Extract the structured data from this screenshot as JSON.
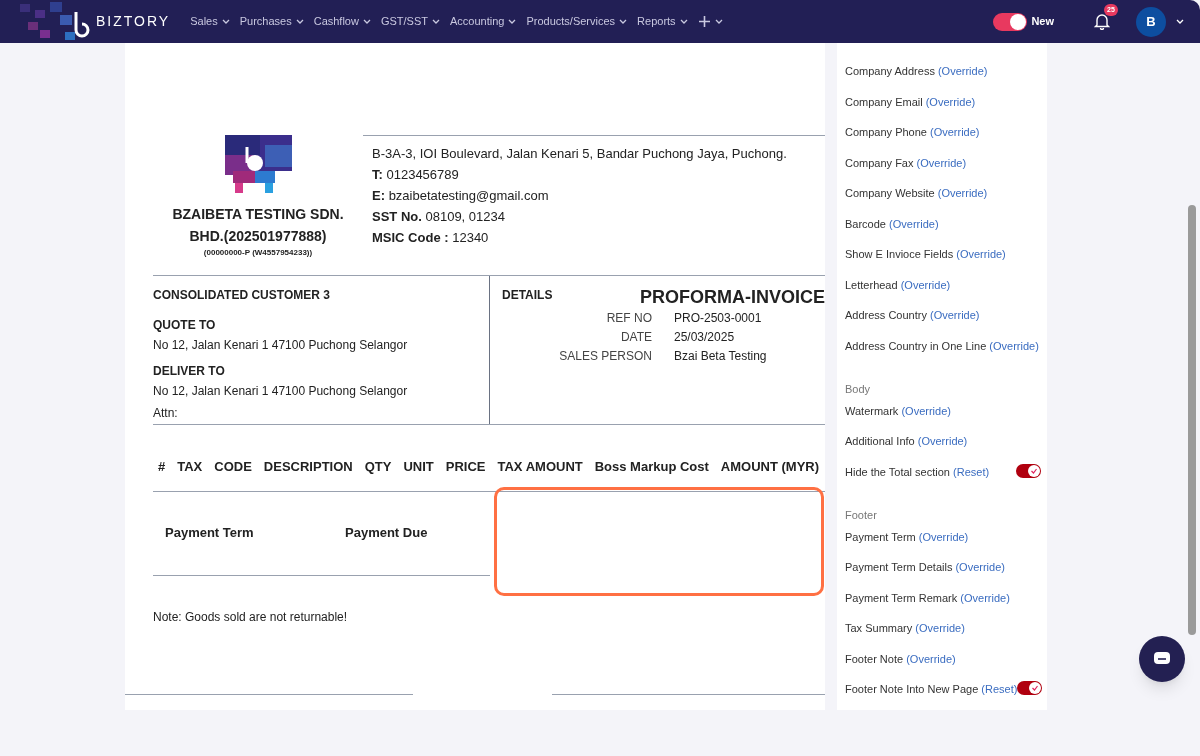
{
  "header": {
    "brand": "BIZTORY",
    "nav": [
      {
        "kind": "menu",
        "label": "Sales"
      },
      {
        "kind": "menu",
        "label": "Purchases"
      },
      {
        "kind": "menu",
        "label": "Cashflow"
      },
      {
        "kind": "menu",
        "label": "GST/SST"
      },
      {
        "kind": "menu",
        "label": "Accounting"
      },
      {
        "kind": "menu",
        "label": "Products/Services"
      },
      {
        "kind": "menu",
        "label": "Reports"
      },
      {
        "kind": "add"
      }
    ],
    "new_toggle": {
      "label": "New",
      "on": true
    },
    "notifications": "25",
    "avatar": "B"
  },
  "invoice": {
    "company_name": "BZAIBETA TESTING SDN. BHD.(202501977888)",
    "company_reg": "(00000000-P (W4557954233))",
    "address": "B-3A-3, IOI Boulevard, Jalan Kenari 5, Bandar Puchong Jaya, Puchong.",
    "contacts": [
      {
        "label": "T:",
        "value": "0123456789"
      },
      {
        "label": "E:",
        "value": "bzaibetatesting@gmail.com"
      },
      {
        "label": "SST No.",
        "value": "08109, 01234"
      },
      {
        "label": "MSIC Code :",
        "value": "12340"
      }
    ],
    "customer": "CONSOLIDATED CUSTOMER 3",
    "quote_to_label": "QUOTE TO",
    "quote_to": "No 12, Jalan Kenari 1 47100 Puchong Selangor",
    "deliver_to_label": "DELIVER TO",
    "deliver_to": "No 12, Jalan Kenari 1 47100 Puchong Selangor",
    "attn": "Attn:",
    "details_label": "DETAILS",
    "doc_title": "PROFORMA-INVOICE",
    "details": [
      {
        "label": "REF NO",
        "value": "PRO-2503-0001"
      },
      {
        "label": "DATE",
        "value": "25/03/2025"
      },
      {
        "label": "SALES PERSON",
        "value": "Bzai Beta Testing"
      }
    ],
    "columns": [
      "#",
      "TAX",
      "CODE",
      "DESCRIPTION",
      "QTY",
      "UNIT",
      "PRICE",
      "TAX AMOUNT",
      "Boss Markup Cost",
      "AMOUNT (MYR)"
    ],
    "payment_term": "Payment Term",
    "payment_due": "Payment Due",
    "note": "Note: Goods sold are not returnable!"
  },
  "settings": [
    {
      "items": [
        {
          "label": "Company Address",
          "action": "(Override)"
        },
        {
          "label": "Company Email",
          "action": "(Override)"
        },
        {
          "label": "Company Phone",
          "action": "(Override)"
        },
        {
          "label": "Company Fax",
          "action": "(Override)"
        },
        {
          "label": "Company Website",
          "action": "(Override)"
        },
        {
          "label": "Barcode",
          "action": "(Override)"
        },
        {
          "label": "Show E Invioce Fields",
          "action": "(Override)"
        },
        {
          "label": "Letterhead",
          "action": "(Override)"
        },
        {
          "label": "Address Country",
          "action": "(Override)"
        },
        {
          "label": "Address Country in One Line",
          "action": "(Override)"
        }
      ]
    },
    {
      "heading": "Body",
      "items": [
        {
          "label": "Watermark",
          "action": "(Override)"
        },
        {
          "label": "Additional Info",
          "action": "(Override)"
        },
        {
          "label": "Hide the Total section",
          "action": "(Reset)",
          "toggle": {
            "on": true
          }
        }
      ]
    },
    {
      "heading": "Footer",
      "items": [
        {
          "label": "Payment Term",
          "action": "(Override)"
        },
        {
          "label": "Payment Term Details",
          "action": "(Override)"
        },
        {
          "label": "Payment Term Remark",
          "action": "(Override)"
        },
        {
          "label": "Tax Summary",
          "action": "(Override)"
        },
        {
          "label": "Footer Note",
          "action": "(Override)"
        },
        {
          "label": "Footer Note Into New Page",
          "action": "(Reset)",
          "toggle": {
            "on": true
          }
        }
      ]
    }
  ]
}
